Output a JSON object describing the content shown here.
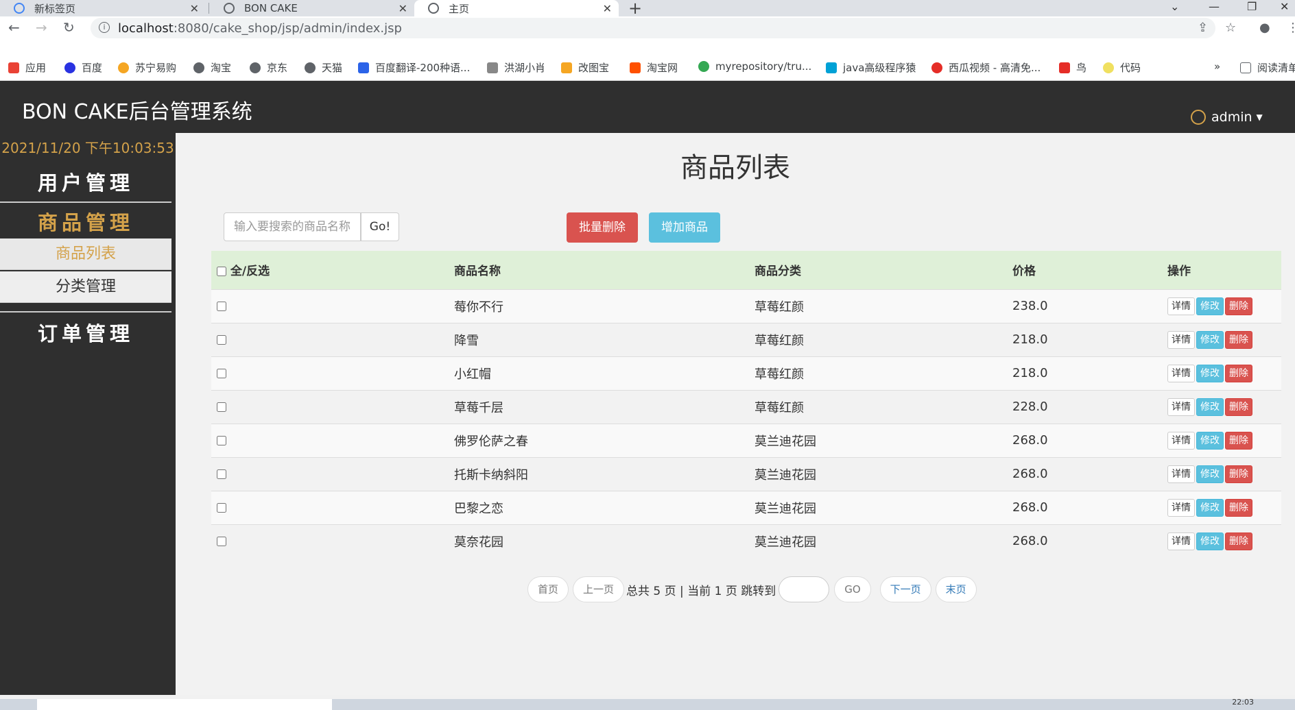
{
  "browser": {
    "tabs": [
      {
        "title": "新标签页"
      },
      {
        "title": "BON CAKE"
      },
      {
        "title": "主页"
      }
    ],
    "url_host": "localhost",
    "url_path": ":8080/cake_shop/jsp/admin/index.jsp",
    "bookmarks": [
      {
        "label": "应用",
        "color": "#e94235"
      },
      {
        "label": "百度",
        "color": "#2932e1"
      },
      {
        "label": "苏宁易购",
        "color": "#f5a623"
      },
      {
        "label": "淘宝",
        "color": "#5f6368"
      },
      {
        "label": "京东",
        "color": "#5f6368"
      },
      {
        "label": "天猫",
        "color": "#5f6368"
      },
      {
        "label": "百度翻译-200种语...",
        "color": "#2b63e8"
      },
      {
        "label": "洪湖小肖",
        "color": "#888"
      },
      {
        "label": "改图宝",
        "color": "#f5a623"
      },
      {
        "label": "淘宝网",
        "color": "#ff5000"
      },
      {
        "label": "myrepository/tru...",
        "color": "#34a853"
      },
      {
        "label": "java高级程序猿",
        "color": "#00a1d6"
      },
      {
        "label": "西瓜视频 - 高清免...",
        "color": "#e52d27"
      },
      {
        "label": "鸟",
        "color": "#e52d27"
      },
      {
        "label": "代码",
        "color": "#f0e060"
      }
    ],
    "more": "»",
    "reading_list": "阅读清单"
  },
  "app": {
    "brand": "BON CAKE后台管理系统",
    "user": "admin",
    "clock": "2021/11/20 下午10:03:53",
    "menu": {
      "user_mgmt": "用户管理",
      "product_mgmt": "商品管理",
      "product_list": "商品列表",
      "category_mgmt": "分类管理",
      "order_mgmt": "订单管理"
    }
  },
  "main": {
    "title": "商品列表",
    "search_placeholder": "输入要搜索的商品名称",
    "go_label": "Go!",
    "batch_delete": "批量删除",
    "add_product": "增加商品",
    "columns": {
      "select_all": "全/反选",
      "name": "商品名称",
      "category": "商品分类",
      "price": "价格",
      "actions": "操作"
    },
    "rows": [
      {
        "name": "莓你不行",
        "category": "草莓红颜",
        "price": "238.0"
      },
      {
        "name": "降雪",
        "category": "草莓红颜",
        "price": "218.0"
      },
      {
        "name": "小红帽",
        "category": "草莓红颜",
        "price": "218.0"
      },
      {
        "name": "草莓千层",
        "category": "草莓红颜",
        "price": "228.0"
      },
      {
        "name": "佛罗伦萨之春",
        "category": "莫兰迪花园",
        "price": "268.0"
      },
      {
        "name": "托斯卡纳斜阳",
        "category": "莫兰迪花园",
        "price": "268.0"
      },
      {
        "name": "巴黎之恋",
        "category": "莫兰迪花园",
        "price": "268.0"
      },
      {
        "name": "莫奈花园",
        "category": "莫兰迪花园",
        "price": "268.0"
      }
    ],
    "row_actions": {
      "detail": "详情",
      "edit": "修改",
      "delete": "删除"
    },
    "pager": {
      "first": "首页",
      "prev": "上一页",
      "info": "总共 5 页 | 当前 1 页 跳转到",
      "go": "GO",
      "next": "下一页",
      "last": "末页"
    }
  },
  "taskbar": {
    "time": "22:03"
  }
}
